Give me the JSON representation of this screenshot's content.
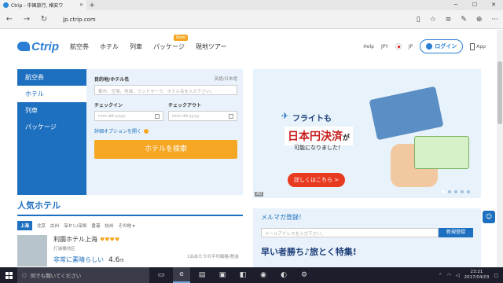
{
  "browser": {
    "tab_title": "Ctrip - 中国旅行, 格安ワ",
    "url": "jp.ctrip.com"
  },
  "site": {
    "logo_text": "Ctrip",
    "nav": [
      "航空券",
      "ホテル",
      "列車",
      "パッケージ",
      "現地ツアー"
    ],
    "new_badge": "New",
    "help": "Help",
    "currency": "JPY",
    "language": "JP",
    "login": "ログイン",
    "app": "App"
  },
  "search": {
    "tabs": [
      "航空券",
      "ホテル",
      "列車",
      "パッケージ"
    ],
    "active_tab": "ホテル",
    "dest_label": "目的地/ホテル名",
    "dest_right": "英語/日本語",
    "dest_placeholder": "都市、空港、地域、ランドマーク、ホテル名を入力下さい。",
    "checkin_label": "チェックイン",
    "checkout_label": "チェックアウト",
    "date_placeholder": "mm-dd-yyyy",
    "advanced": "詳細オプションを開く",
    "button": "ホテルを検索"
  },
  "banner": {
    "line1": "フライトも",
    "line2": "日本円決済",
    "line2_suffix": "が",
    "line3": "可能になりました！",
    "button": "詳しくはこちら >",
    "ad": "AD"
  },
  "popular": {
    "title": "人気ホテル",
    "cities": [
      "上海",
      "北京",
      "広州",
      "深セン/深圳",
      "香港",
      "杭州",
      "その他"
    ],
    "hotel_name": "利園ホテル上海",
    "hotel_stars": "♥♥♥♥",
    "hotel_area": "打浦橋地区",
    "rating_text": "非常に素晴らしい",
    "score": "4.6",
    "score_max": "/5",
    "price_note": "1泊あたりの平均価格(税金"
  },
  "mail": {
    "title": "メルマガ登録！",
    "placeholder": "メールアドレスを入力下さい。",
    "button": "新規登録",
    "big_text": "早い者勝ち♪旅とく特集!"
  },
  "taskbar": {
    "search_text": "何でも聞いてください",
    "time": "23:21",
    "date": "2017/04/03"
  }
}
